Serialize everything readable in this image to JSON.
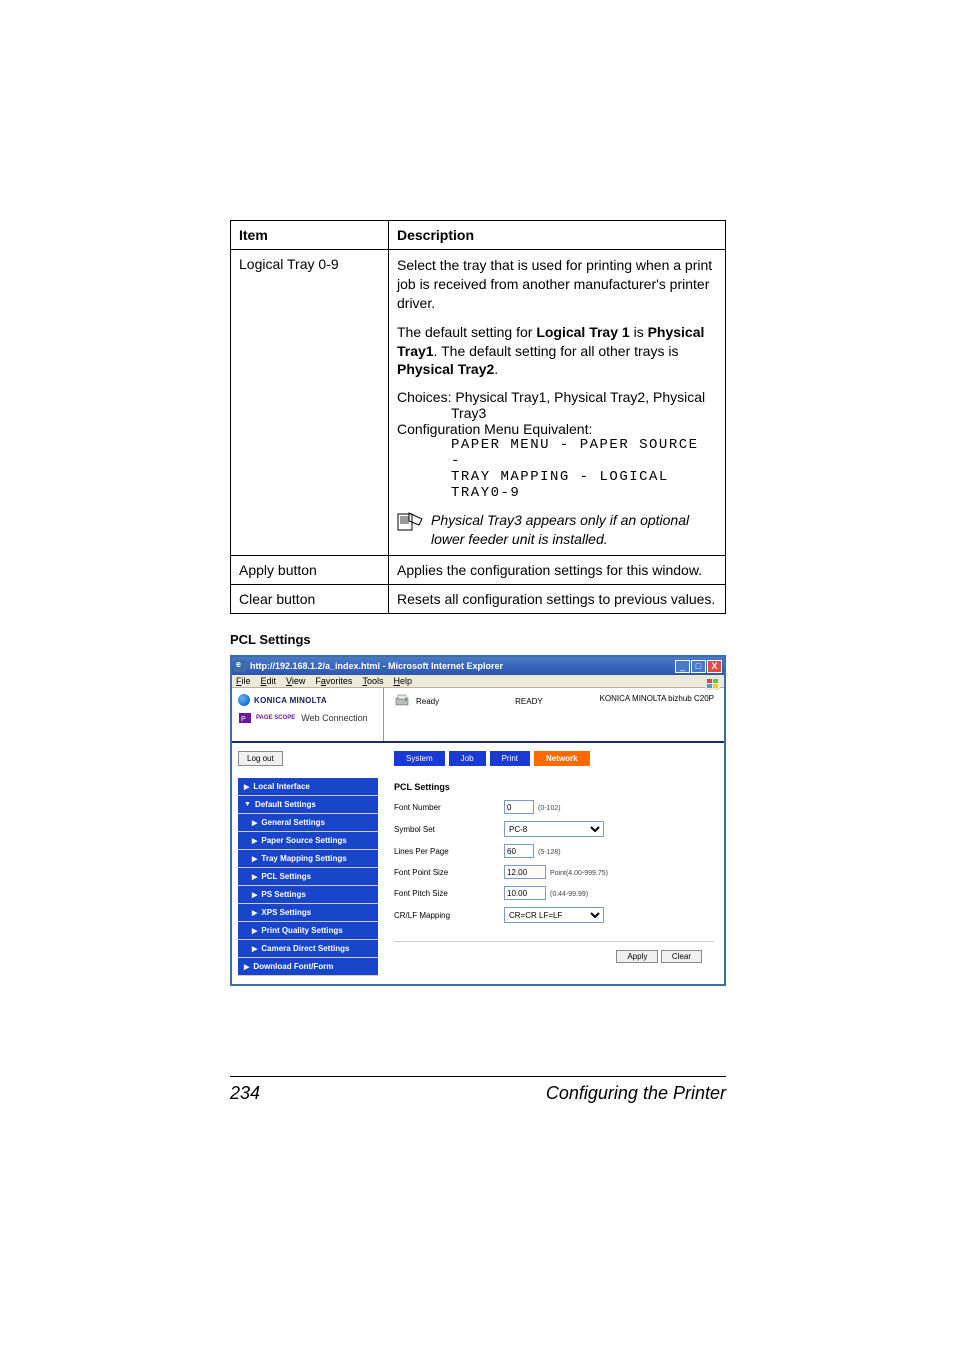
{
  "table": {
    "head_item": "Item",
    "head_desc": "Description",
    "row1_item": "Logical Tray 0-9",
    "row1_p1a": "Select the tray that is used for printing when a print job is received from another manufacturer's printer driver.",
    "row1_p2_pre": "The default setting for ",
    "row1_p2_b1": "Logical Tray 1",
    "row1_p2_mid": " is ",
    "row1_p2_b2": "Physical Tray1",
    "row1_p2_mid2": ". The default setting for all other trays is ",
    "row1_p2_b3": "Physical Tray2",
    "row1_p2_end": ".",
    "row1_choices": "Choices: Physical Tray1, Physical Tray2, Physical",
    "row1_choices2": "Tray3",
    "row1_cfg": "Configuration Menu Equivalent:",
    "row1_mono1": "PAPER MENU - PAPER SOURCE -",
    "row1_mono2": "TRAY MAPPING - LOGICAL",
    "row1_mono3": "TRAY0-9",
    "row1_note": "Physical Tray3 appears only if an optional lower feeder unit is installed.",
    "row2_item": "Apply button",
    "row2_desc": "Applies the configuration settings for this window.",
    "row3_item": "Clear button",
    "row3_desc": "Resets all configuration settings to previous values."
  },
  "subhead": "PCL Settings",
  "browser": {
    "title": "http://192.168.1.2/a_index.html - Microsoft Internet Explorer",
    "menu": {
      "file": "File",
      "edit": "Edit",
      "view": "View",
      "fav": "Favorites",
      "tools": "Tools",
      "help": "Help"
    },
    "brand_top": "KONICA MINOLTA",
    "brand_ps": "PAGE SCOPE",
    "brand_bot": "Web Connection",
    "status_ready_small": "Ready",
    "status_ready_big": "READY",
    "model": "KONICA MINOLTA bizhub C20P",
    "logout": "Log out",
    "tabs": {
      "system": "System",
      "job": "Job",
      "print": "Print",
      "network": "Network"
    },
    "side": {
      "local": "Local Interface",
      "default": "Default Settings",
      "general": "General Settings",
      "paper": "Paper Source Settings",
      "tray": "Tray Mapping Settings",
      "pcl": "PCL Settings",
      "ps": "PS Settings",
      "xps": "XPS Settings",
      "pq": "Print Quality Settings",
      "camera": "Camera Direct Settings",
      "download": "Download Font/Form"
    },
    "panel_title": "PCL Settings",
    "form": {
      "font_number_l": "Font Number",
      "font_number_v": "0",
      "font_number_h": "(0-102)",
      "symbol_l": "Symbol Set",
      "symbol_v": "PC-8",
      "lpp_l": "Lines Per Page",
      "lpp_v": "60",
      "lpp_h": "(5-128)",
      "fps_l": "Font Point Size",
      "fps_v": "12.00",
      "fps_h": "Point(4.00-999.75)",
      "fpitch_l": "Font Pitch Size",
      "fpitch_v": "10.00",
      "fpitch_h": "(0.44-99.99)",
      "crlf_l": "CR/LF Mapping",
      "crlf_v": "CR=CR LF=LF"
    },
    "apply": "Apply",
    "clear": "Clear"
  },
  "footer": {
    "page": "234",
    "title": "Configuring the Printer"
  }
}
